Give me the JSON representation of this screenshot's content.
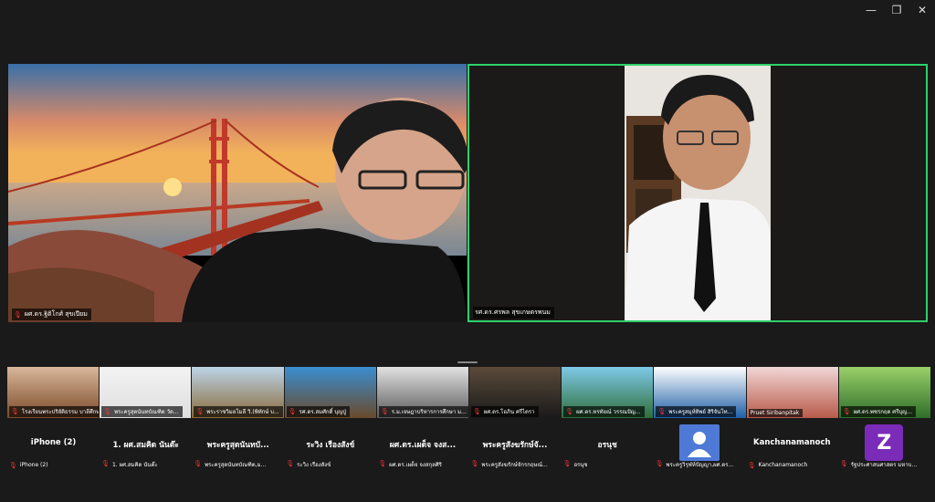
{
  "window_controls": {
    "minimize": "—",
    "restore": "❐",
    "close": "✕"
  },
  "speakers": [
    {
      "name": "ผศ.ดร.ฐิติโกศ์ สุขเปียม",
      "background": "golden-gate-sunset"
    },
    {
      "name": "รศ.ดร.ศรพล สุขเกษตรพนม",
      "background": "home-office"
    }
  ],
  "thumbnails": [
    {
      "name": "โรงเรียนพระปริยัติธรรม บาลีศึกษา"
    },
    {
      "name": "พระครูสุตนันทบัณฑิต วัด..."
    },
    {
      "name": "พระราชวิมลโมลี วิ.(พิทักษ์ บ..."
    },
    {
      "name": "รศ.ดร.สมศักดิ์ บุญปู่"
    },
    {
      "name": "ร.ม.เจษฎาบริหารการศึกษา ม..."
    },
    {
      "name": "ผศ.ดร.โอภิน ศรีไตรา"
    },
    {
      "name": "ผศ.ดร.หรทัยณ์ วรรณปัญ..."
    },
    {
      "name": "พระครูสมุห์ทิพย์ สิริจันโท..."
    },
    {
      "name": "Pruet Siribanpitak"
    },
    {
      "name": "ผศ.ดร.พชรกฤต ศรีบุญ..."
    }
  ],
  "participants": [
    {
      "display": "iPhone (2)",
      "label": "iPhone (2)"
    },
    {
      "display": "1. ผศ.สมคิด นันต๊ะ",
      "label": "1. ผศ.สมคิด นันต๊ะ"
    },
    {
      "display": "พระครูสุตนันทบั...",
      "label": "พระครูสุตนันทบัณฑิต,ม..."
    },
    {
      "display": "ระวิง เรืองสังข์",
      "label": "ระวิง เรืองสังข์"
    },
    {
      "display": "ผศ.ดร.เผด็จ จงส...",
      "label": "ผศ.ดร.เผด็จ จงสกุลศิริ"
    },
    {
      "display": "พระครูสังฆรักษ์จั...",
      "label": "พระครูสังฆรักษ์จักรกฤษณ์..."
    },
    {
      "display": "อรนุช",
      "label": "อรนุช"
    },
    {
      "display": "",
      "label": "พระครูวิรุฬห์ปัญญา,ผศ.ดร..."
    },
    {
      "display": "Kanchanamanoch",
      "label": "Kanchanamanoch"
    },
    {
      "display": "",
      "label": "รัฐประศาสนศาสตร มหาบ..."
    }
  ],
  "avatar_letter": "Z",
  "colors": {
    "active_speaker_border": "#2ed16b",
    "mic_muted": "#e33333",
    "background": "#1a1a1a"
  }
}
